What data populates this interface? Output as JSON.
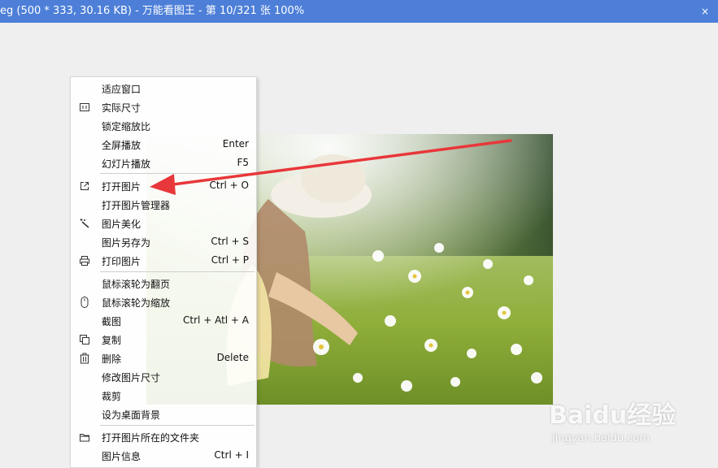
{
  "window": {
    "title": "eg (500 * 333, 30.16 KB) - 万能看图王 - 第 10/321 张 100%",
    "close_glyph": "×"
  },
  "colors": {
    "titlebar": "#4d7fd8",
    "viewer_bg": "#efefef",
    "arrow": "#e8373a"
  },
  "context_menu": {
    "items": [
      {
        "label": "适应窗口",
        "shortcut": "",
        "icon": ""
      },
      {
        "label": "实际尺寸",
        "shortcut": "",
        "icon": "actual-size-icon"
      },
      {
        "label": "锁定缩放比",
        "shortcut": "",
        "icon": ""
      },
      {
        "label": "全屏播放",
        "shortcut": "Enter",
        "icon": ""
      },
      {
        "label": "幻灯片播放",
        "shortcut": "F5",
        "icon": ""
      },
      {
        "label": "打开图片",
        "shortcut": "Ctrl + O",
        "icon": "open-external-icon"
      },
      {
        "label": "打开图片管理器",
        "shortcut": "",
        "icon": ""
      },
      {
        "label": "图片美化",
        "shortcut": "",
        "icon": "magic-wand-icon"
      },
      {
        "label": "图片另存为",
        "shortcut": "Ctrl + S",
        "icon": ""
      },
      {
        "label": "打印图片",
        "shortcut": "Ctrl + P",
        "icon": "printer-icon"
      },
      {
        "label": "鼠标滚轮为翻页",
        "shortcut": "",
        "icon": ""
      },
      {
        "label": "鼠标滚轮为缩放",
        "shortcut": "",
        "icon": "mouse-icon"
      },
      {
        "label": "截图",
        "shortcut": "Ctrl + Atl + A",
        "icon": ""
      },
      {
        "label": "复制",
        "shortcut": "",
        "icon": "copy-icon"
      },
      {
        "label": "删除",
        "shortcut": "Delete",
        "icon": "trash-icon"
      },
      {
        "label": "修改图片尺寸",
        "shortcut": "",
        "icon": ""
      },
      {
        "label": "裁剪",
        "shortcut": "",
        "icon": ""
      },
      {
        "label": "设为桌面背景",
        "shortcut": "",
        "icon": ""
      },
      {
        "label": "打开图片所在的文件夹",
        "shortcut": "",
        "icon": "folder-icon"
      },
      {
        "label": "图片信息",
        "shortcut": "Ctrl + I",
        "icon": ""
      }
    ]
  },
  "watermark": {
    "logo": "Baidu经验",
    "url": "jingyan.baidu.com"
  }
}
